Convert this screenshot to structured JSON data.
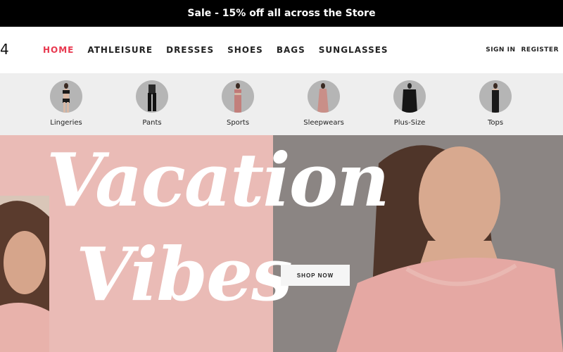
{
  "announcement": "Sale - 15% off all across the Store",
  "logo": "4",
  "nav": {
    "items": [
      {
        "label": "HOME",
        "active": true
      },
      {
        "label": "ATHLEISURE"
      },
      {
        "label": "DRESSES"
      },
      {
        "label": "SHOES"
      },
      {
        "label": "BAGS"
      },
      {
        "label": "SUNGLASSES"
      }
    ]
  },
  "account": {
    "sign_in": "SIGN IN",
    "register": "REGISTER"
  },
  "categories": [
    {
      "label": "Lingeries"
    },
    {
      "label": "Pants"
    },
    {
      "label": "Sports"
    },
    {
      "label": "Sleepwears"
    },
    {
      "label": "Plus-Size"
    },
    {
      "label": "Tops"
    }
  ],
  "hero": {
    "line1": "Vacation",
    "line2": "Vibes",
    "cta": "SHOP NOW"
  },
  "colors": {
    "accent": "#e8384f",
    "hero_pink": "#eabbb6",
    "announcement_bg": "#000000"
  }
}
